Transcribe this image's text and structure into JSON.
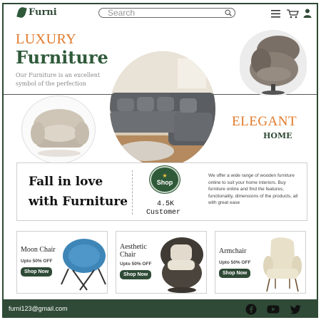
{
  "header": {
    "logo_text": "Furni",
    "search_placeholder": "Search"
  },
  "hero": {
    "title_accent": "LUXURY",
    "title_main": "Furniture",
    "subtitle": "Our Furniture is an excellent symbol of the perfection",
    "tag_accent": "ELEGANT",
    "tag_main": "HOME"
  },
  "band": {
    "headline": "Fall in love with Furniture",
    "shop_label": "Shop",
    "stat_value": "4.5K",
    "stat_label": "Customer",
    "description": "We offer a wide range of wooden furniture online to suit your home interiors. Buy furniture online and find the features, functionality, dimensions of the products, all with great ease"
  },
  "products": [
    {
      "name": "Moon Chair",
      "offer": "Upto 50% OFF",
      "button": "Shop Now"
    },
    {
      "name": "Aesthetic Chair",
      "offer": "Upto 50% OFF",
      "button": "Shop Now"
    },
    {
      "name": "Armchair",
      "offer": "Upto 50% OFF",
      "button": "Shop Now"
    }
  ],
  "footer": {
    "email": "furni123@gmail.com",
    "social": [
      "facebook-icon",
      "youtube-icon",
      "twitter-icon"
    ]
  },
  "colors": {
    "brand_green": "#2f4a36",
    "accent_orange": "#e07a2c"
  }
}
